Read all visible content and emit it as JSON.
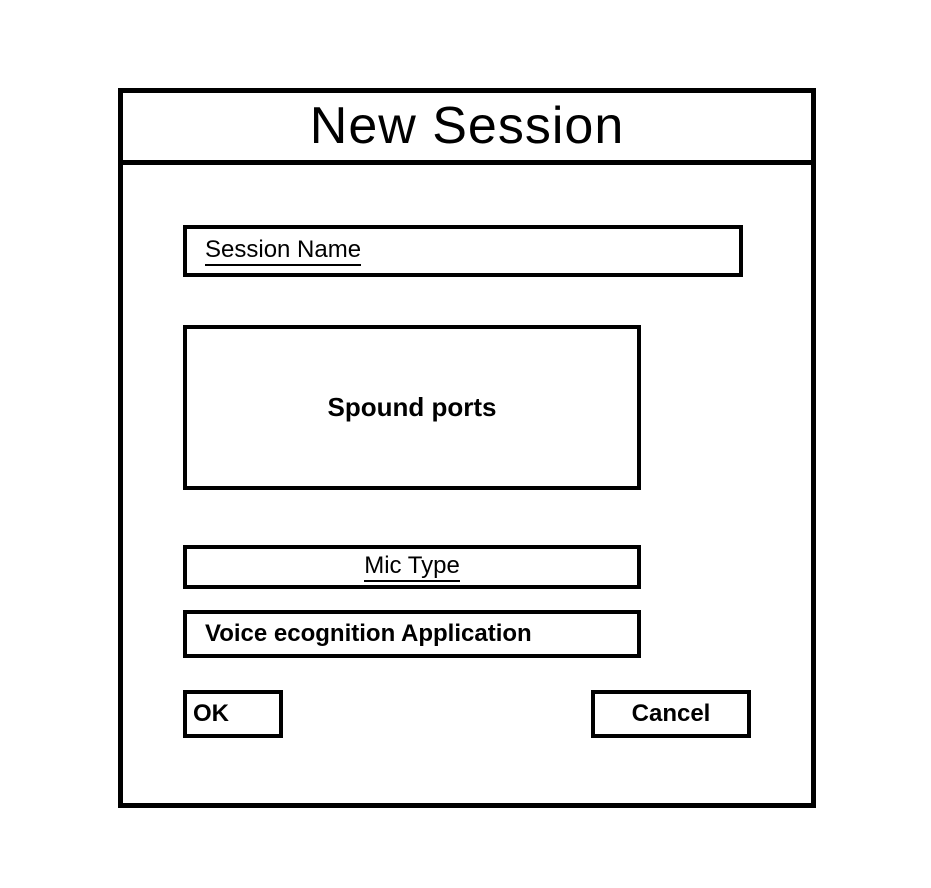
{
  "dialog": {
    "title": "New Session",
    "fields": {
      "session_name_label": "Session Name",
      "sound_ports_label": "Spound ports",
      "mic_type_label": "Mic Type",
      "voice_recognition_label": "Voice ecognition Application"
    },
    "buttons": {
      "ok": "OK",
      "cancel": "Cancel"
    }
  }
}
